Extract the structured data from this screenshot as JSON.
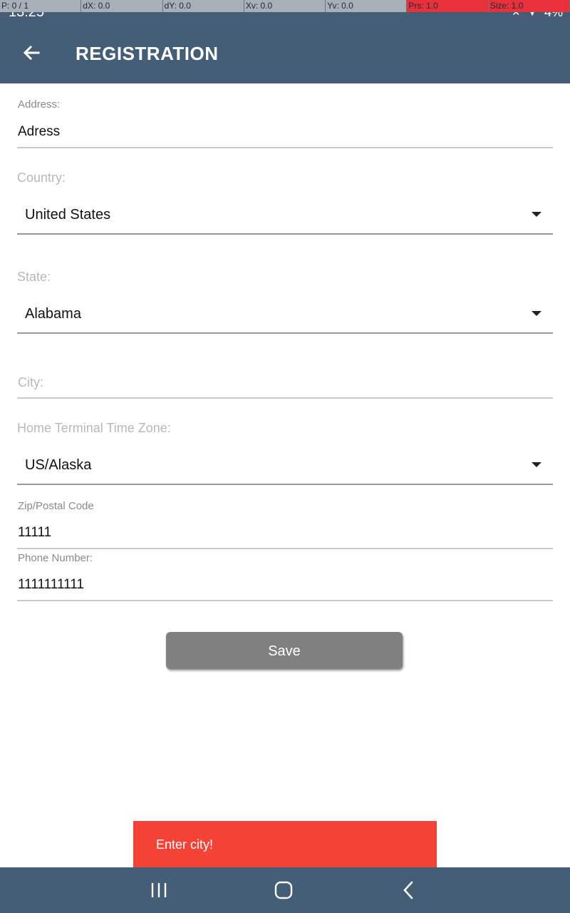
{
  "debug": {
    "p": "P: 0 / 1",
    "dx": "dX: 0.0",
    "dy": "dY: 0.0",
    "xv": "Xv: 0.0",
    "yv": "Yv: 0.0",
    "prs": "Prs: 1.0",
    "size": "Size: 1.0"
  },
  "status": {
    "time": "13:25",
    "battery": "4%"
  },
  "appbar": {
    "title": "REGISTRATION"
  },
  "form": {
    "address": {
      "label": "Address:",
      "value": "Adress"
    },
    "country": {
      "label": "Country:",
      "value": "United States"
    },
    "state": {
      "label": "State:",
      "value": "Alabama"
    },
    "city": {
      "placeholder": "City:"
    },
    "timezone": {
      "label": "Home Terminal Time Zone:",
      "value": "US/Alaska"
    },
    "zip": {
      "label": "Zip/Postal Code",
      "value": "11111"
    },
    "phone": {
      "label": "Phone Number:",
      "value": "1111111111"
    }
  },
  "save_label": "Save",
  "toast_message": "Enter city!",
  "icons": {
    "back": "arrow-back-icon",
    "dropdown": "dropdown-caret-icon",
    "recents": "recent-apps-icon",
    "home": "home-icon",
    "nav_back": "nav-back-icon"
  },
  "colors": {
    "primary": "#455e78",
    "toast": "#f44336",
    "button": "#808080"
  }
}
